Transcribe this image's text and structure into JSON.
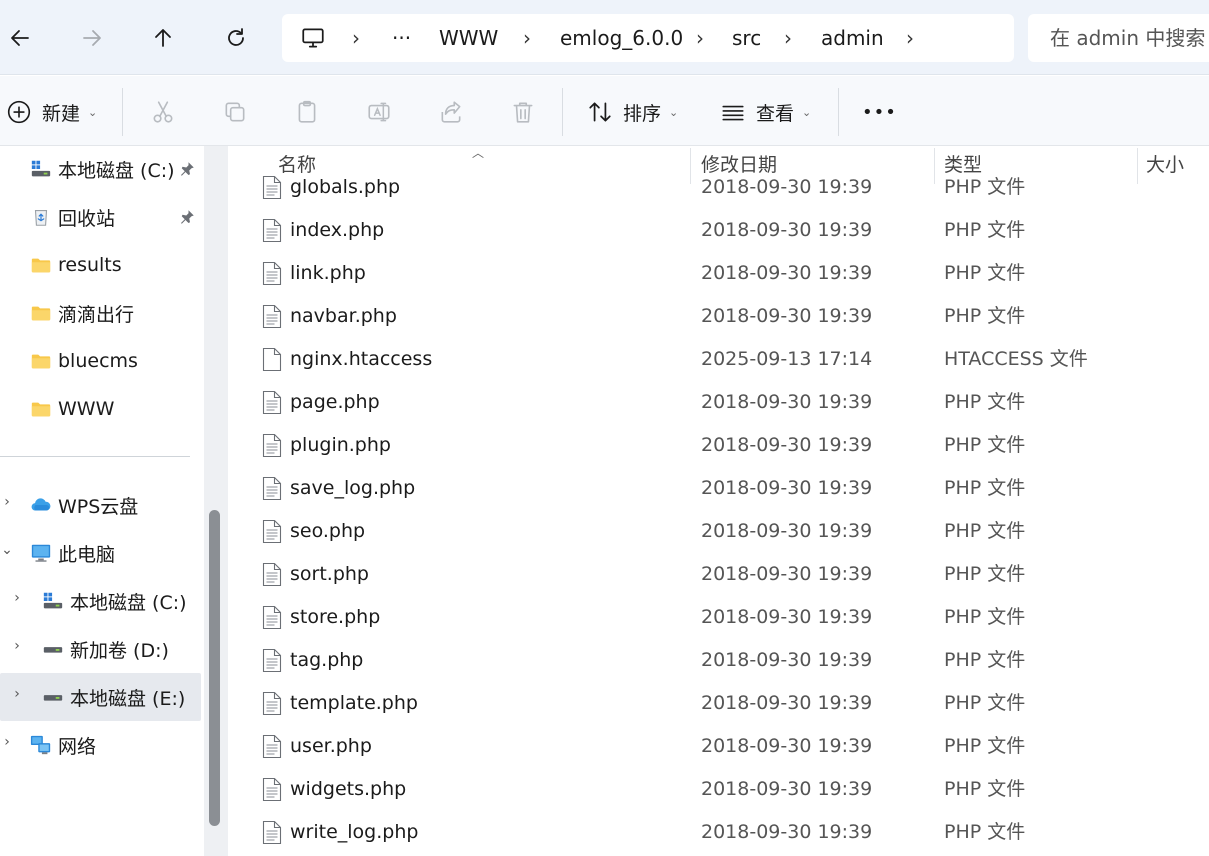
{
  "address_bar": {
    "breadcrumb": [
      "WWW",
      "emlog_6.0.0",
      "src",
      "admin"
    ],
    "overflow_label": "···",
    "separator": "›",
    "search_placeholder": "在 admin 中搜索"
  },
  "command_bar": {
    "new_label": "新建",
    "sort_label": "排序",
    "view_label": "查看",
    "more_label": "•••"
  },
  "sidebar": {
    "quick_access": [
      {
        "label": "本地磁盘 (C:)",
        "icon": "drive-icon",
        "pinned": true
      },
      {
        "label": "回收站",
        "icon": "recycle-bin-icon",
        "pinned": true
      },
      {
        "label": "results",
        "icon": "folder-icon"
      },
      {
        "label": "滴滴出行",
        "icon": "folder-icon"
      },
      {
        "label": "bluecms",
        "icon": "folder-icon"
      },
      {
        "label": "WWW",
        "icon": "folder-icon"
      }
    ],
    "tree": [
      {
        "label": "WPS云盘",
        "icon": "cloud-icon",
        "expander": "›"
      },
      {
        "label": "此电脑",
        "icon": "computer-icon",
        "expander": "⌄"
      },
      {
        "label": "本地磁盘 (C:)",
        "icon": "drive-icon",
        "expander": "›"
      },
      {
        "label": "新加卷 (D:)",
        "icon": "drive-icon",
        "expander": "›"
      },
      {
        "label": "本地磁盘 (E:)",
        "icon": "drive-icon",
        "expander": "›",
        "selected": true
      },
      {
        "label": "网络",
        "icon": "network-icon",
        "expander": "›"
      }
    ]
  },
  "file_list": {
    "columns": {
      "name": "名称",
      "date": "修改日期",
      "type": "类型",
      "size": "大小"
    },
    "rows": [
      {
        "name": "globals.php",
        "date": "2018-09-30 19:39",
        "type": "PHP 文件"
      },
      {
        "name": "index.php",
        "date": "2018-09-30 19:39",
        "type": "PHP 文件"
      },
      {
        "name": "link.php",
        "date": "2018-09-30 19:39",
        "type": "PHP 文件"
      },
      {
        "name": "navbar.php",
        "date": "2018-09-30 19:39",
        "type": "PHP 文件"
      },
      {
        "name": "nginx.htaccess",
        "date": "2025-09-13 17:14",
        "type": "HTACCESS 文件"
      },
      {
        "name": "page.php",
        "date": "2018-09-30 19:39",
        "type": "PHP 文件"
      },
      {
        "name": "plugin.php",
        "date": "2018-09-30 19:39",
        "type": "PHP 文件"
      },
      {
        "name": "save_log.php",
        "date": "2018-09-30 19:39",
        "type": "PHP 文件"
      },
      {
        "name": "seo.php",
        "date": "2018-09-30 19:39",
        "type": "PHP 文件"
      },
      {
        "name": "sort.php",
        "date": "2018-09-30 19:39",
        "type": "PHP 文件"
      },
      {
        "name": "store.php",
        "date": "2018-09-30 19:39",
        "type": "PHP 文件"
      },
      {
        "name": "tag.php",
        "date": "2018-09-30 19:39",
        "type": "PHP 文件"
      },
      {
        "name": "template.php",
        "date": "2018-09-30 19:39",
        "type": "PHP 文件"
      },
      {
        "name": "user.php",
        "date": "2018-09-30 19:39",
        "type": "PHP 文件"
      },
      {
        "name": "widgets.php",
        "date": "2018-09-30 19:39",
        "type": "PHP 文件"
      },
      {
        "name": "write_log.php",
        "date": "2018-09-30 19:39",
        "type": "PHP 文件"
      }
    ]
  },
  "colors": {
    "address_bg": "#eef3fa",
    "command_bg": "#f7f9fc",
    "selected_bg": "#e6e9ee",
    "folder_yellow": "#f8c84a",
    "accent_blue": "#2b7bd6"
  }
}
